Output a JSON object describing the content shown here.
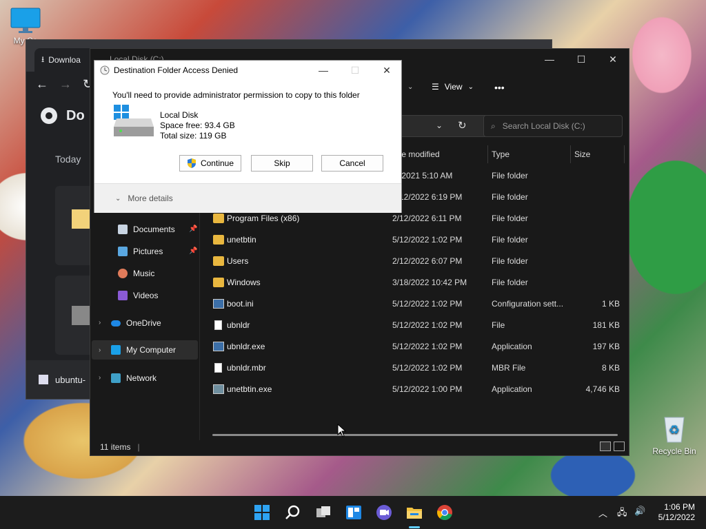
{
  "desktop": {
    "icons": [
      {
        "label": "My Co"
      },
      {
        "label": "Recycle Bin"
      }
    ]
  },
  "chrome": {
    "tab_label": "Downloa",
    "header_title": "Do",
    "section_today": "Today",
    "bottom_item": "ubuntu-"
  },
  "explorer": {
    "title": "Local Disk (C:)",
    "cmdbar": {
      "view_label": "View",
      "more": "•••"
    },
    "search_placeholder": "Search Local Disk (C:)",
    "columns": {
      "date_modified": "te modified",
      "type": "Type",
      "size": "Size"
    },
    "nav": [
      {
        "label": "Documents",
        "pinned": true
      },
      {
        "label": "Pictures",
        "pinned": true
      },
      {
        "label": "Music"
      },
      {
        "label": "Videos"
      },
      {
        "label": "OneDrive"
      },
      {
        "label": "My Computer"
      },
      {
        "label": "Network"
      }
    ],
    "files": [
      {
        "name": "",
        "date": "/6/2021 5:10 AM",
        "type": "File folder",
        "size": "",
        "kind": "folder"
      },
      {
        "name": "",
        "date": "2/12/2022 6:19 PM",
        "type": "File folder",
        "size": "",
        "kind": "folder"
      },
      {
        "name": "Program Files (x86)",
        "date": "2/12/2022 6:11 PM",
        "type": "File folder",
        "size": "",
        "kind": "folder"
      },
      {
        "name": "unetbtin",
        "date": "5/12/2022 1:02 PM",
        "type": "File folder",
        "size": "",
        "kind": "folder"
      },
      {
        "name": "Users",
        "date": "2/12/2022 6:07 PM",
        "type": "File folder",
        "size": "",
        "kind": "folder"
      },
      {
        "name": "Windows",
        "date": "3/18/2022 10:42 PM",
        "type": "File folder",
        "size": "",
        "kind": "folder"
      },
      {
        "name": "boot.ini",
        "date": "5/12/2022 1:02 PM",
        "type": "Configuration sett...",
        "size": "1 KB",
        "kind": "config"
      },
      {
        "name": "ubnldr",
        "date": "5/12/2022 1:02 PM",
        "type": "File",
        "size": "181 KB",
        "kind": "file"
      },
      {
        "name": "ubnldr.exe",
        "date": "5/12/2022 1:02 PM",
        "type": "Application",
        "size": "197 KB",
        "kind": "app"
      },
      {
        "name": "ubnldr.mbr",
        "date": "5/12/2022 1:02 PM",
        "type": "MBR File",
        "size": "8 KB",
        "kind": "file"
      },
      {
        "name": "unetbtin.exe",
        "date": "5/12/2022 1:00 PM",
        "type": "Application",
        "size": "4,746 KB",
        "kind": "exe"
      }
    ],
    "status": "11 items"
  },
  "dialog": {
    "title": "Destination Folder Access Denied",
    "message": "You'll need to provide administrator permission to copy to this folder",
    "drive_name": "Local Disk",
    "space_free": "Space free: 93.4 GB",
    "total_size": "Total size: 119 GB",
    "buttons": {
      "continue": "Continue",
      "skip": "Skip",
      "cancel": "Cancel"
    },
    "more_details": "More details"
  },
  "taskbar": {
    "time": "1:06 PM",
    "date": "5/12/2022"
  },
  "colors": {
    "accent": "#0078d4",
    "folder": "#e9b73f"
  }
}
